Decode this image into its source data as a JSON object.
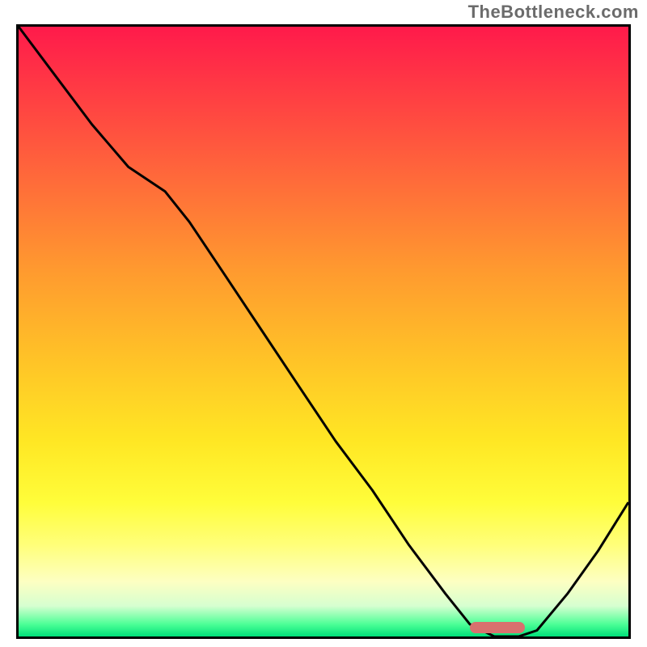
{
  "watermark": "TheBottleneck.com",
  "chart_data": {
    "type": "line",
    "title": "",
    "xlabel": "",
    "ylabel": "",
    "xlim": [
      0,
      100
    ],
    "ylim": [
      0,
      100
    ],
    "grid": false,
    "legend": false,
    "series": [
      {
        "name": "bottleneck-curve",
        "x": [
          0,
          6,
          12,
          18,
          24,
          28,
          34,
          40,
          46,
          52,
          58,
          64,
          70,
          74,
          78,
          82,
          85,
          90,
          95,
          100
        ],
        "values": [
          100,
          92,
          84,
          77,
          73,
          68,
          59,
          50,
          41,
          32,
          24,
          15,
          7,
          2,
          0,
          0,
          1,
          7,
          14,
          22
        ]
      }
    ],
    "highlight_band": {
      "x_start": 74,
      "x_end": 83,
      "color": "#d9716e"
    },
    "gradient_stops": [
      {
        "pos": 0,
        "color": "#ff1a4b"
      },
      {
        "pos": 25,
        "color": "#ff6a3a"
      },
      {
        "pos": 55,
        "color": "#ffc427"
      },
      {
        "pos": 78,
        "color": "#fffd3a"
      },
      {
        "pos": 95,
        "color": "#d6ffd0"
      },
      {
        "pos": 100,
        "color": "#00e07a"
      }
    ]
  },
  "plot": {
    "inner_w": 754,
    "inner_h": 754
  }
}
